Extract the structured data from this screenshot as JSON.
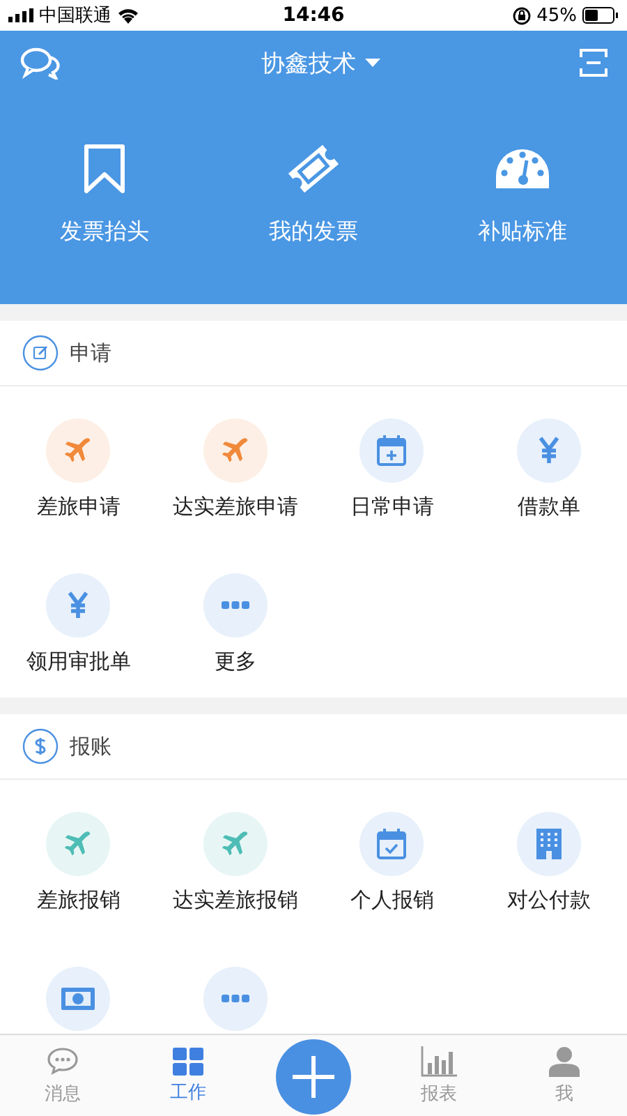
{
  "status_bar": {
    "carrier": "中国联通",
    "time": "14:46",
    "battery": "45%"
  },
  "header": {
    "title": "协鑫技术"
  },
  "shortcuts": [
    {
      "kind": "bookmark",
      "label": "发票抬头"
    },
    {
      "kind": "ticket",
      "label": "我的发票"
    },
    {
      "kind": "gauge",
      "label": "补贴标准"
    }
  ],
  "sections": [
    {
      "kind": "edit",
      "title": "申请",
      "items": [
        {
          "kind": "plane",
          "color": "#f0893a",
          "label": "差旅申请"
        },
        {
          "kind": "plane",
          "color": "#f0893a",
          "label": "达实差旅申请"
        },
        {
          "kind": "calendar-plus",
          "color": "#4a90e2",
          "label": "日常申请"
        },
        {
          "kind": "yen",
          "color": "#4a90e2",
          "label": "借款单"
        },
        {
          "kind": "yen",
          "color": "#4a90e2",
          "label": "领用审批单"
        },
        {
          "kind": "more",
          "color": "#4a90e2",
          "label": "更多"
        }
      ]
    },
    {
      "kind": "dollar",
      "title": "报账",
      "items": [
        {
          "kind": "plane",
          "color": "#4dbdb5",
          "label": "差旅报销"
        },
        {
          "kind": "plane",
          "color": "#4dbdb5",
          "label": "达实差旅报销"
        },
        {
          "kind": "calendar-check",
          "color": "#4a90e2",
          "label": "个人报销"
        },
        {
          "kind": "building",
          "color": "#4a90e2",
          "label": "对公付款"
        },
        {
          "kind": "banknote",
          "color": "#4a90e2"
        },
        {
          "kind": "more",
          "color": "#4a90e2"
        }
      ]
    }
  ],
  "tab_bar": [
    {
      "kind": "chat",
      "label": "消息",
      "selected": false
    },
    {
      "kind": "grid",
      "label": "工作",
      "selected": true
    },
    {
      "kind": "plus"
    },
    {
      "kind": "chart",
      "label": "报表",
      "selected": false
    },
    {
      "kind": "person",
      "label": "我",
      "selected": false
    }
  ]
}
